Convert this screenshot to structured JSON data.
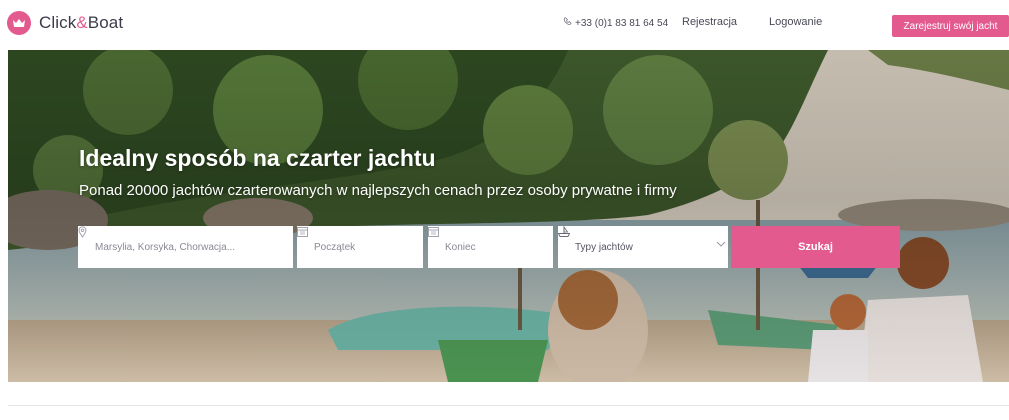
{
  "header": {
    "logo_text_a": "Click",
    "logo_text_amp": "&",
    "logo_text_b": "Boat",
    "phone": "+33 (0)1 83 81 64 54",
    "register": "Rejestracja",
    "login": "Logowanie",
    "cta": "Zarejestruj swój jacht"
  },
  "hero": {
    "title": "Idealny sposób na czarter jachtu",
    "subtitle": "Ponad 20000 jachtów czarterowanych w najlepszych cenach przez osoby prywatne i firmy"
  },
  "search": {
    "destination_placeholder": "Marsylia, Korsyka, Chorwacja...",
    "start_placeholder": "Początek",
    "end_placeholder": "Koniec",
    "type_label": "Typy jachtów",
    "button": "Szukaj"
  },
  "colors": {
    "brand": "#e35a8f",
    "text": "#4a4a57"
  }
}
